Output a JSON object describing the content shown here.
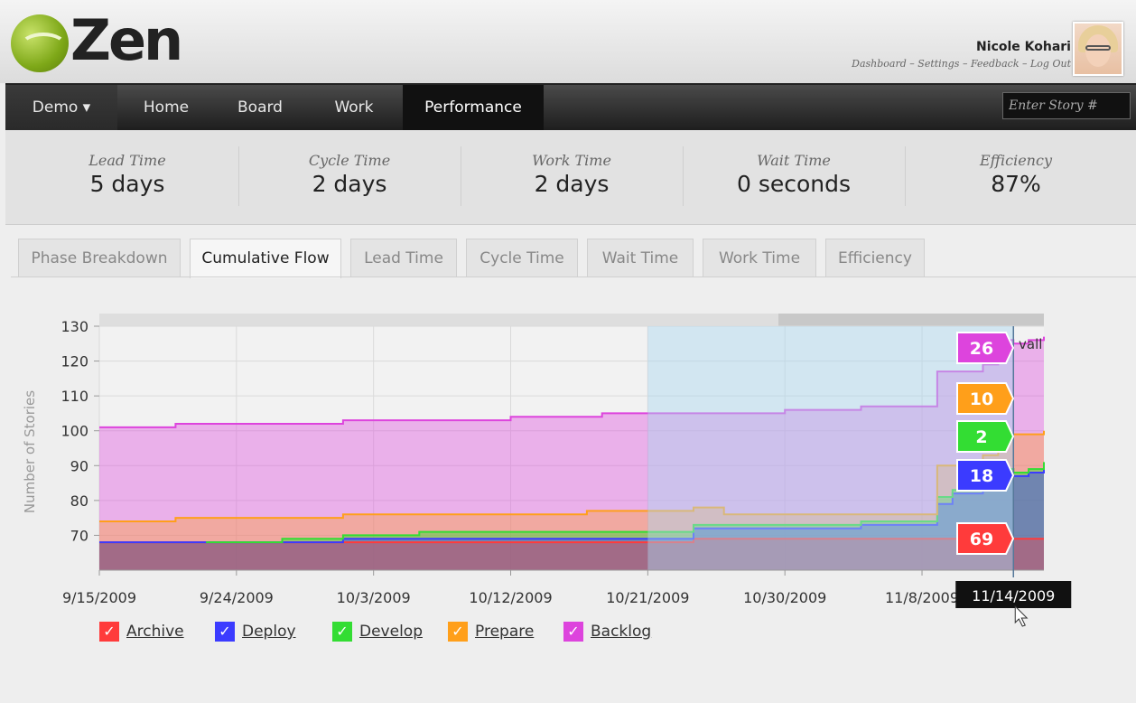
{
  "app": {
    "logo_text": "Zen"
  },
  "user": {
    "name": "Nicole Kohari",
    "links": [
      "Dashboard",
      "Settings",
      "Feedback",
      "Log Out"
    ]
  },
  "nav": {
    "demo_label": "Demo ▾",
    "items": [
      "Home",
      "Board",
      "Work",
      "Performance"
    ],
    "active": "Performance",
    "story_placeholder": "Enter Story #"
  },
  "stats": [
    {
      "label": "Lead Time",
      "value": "5 days"
    },
    {
      "label": "Cycle Time",
      "value": "2 days"
    },
    {
      "label": "Work Time",
      "value": "2 days"
    },
    {
      "label": "Wait Time",
      "value": "0 seconds"
    },
    {
      "label": "Efficiency",
      "value": "87%"
    }
  ],
  "tabs": [
    "Phase Breakdown",
    "Cumulative Flow",
    "Lead Time",
    "Cycle Time",
    "Wait Time",
    "Work Time",
    "Efficiency"
  ],
  "active_tab": "Cumulative Flow",
  "colors": {
    "archive": "#ff3b3b",
    "deploy": "#3b3bff",
    "develop": "#33dd33",
    "prepare": "#ff9f1a",
    "backlog": "#dd44dd",
    "selection": "#aad8f0",
    "navbar": "#2a2a2a"
  },
  "chart_data": {
    "type": "area",
    "stacked": true,
    "ylabel": "Number of Stories",
    "ylim": [
      60,
      130
    ],
    "yticks": [
      70,
      80,
      90,
      100,
      110,
      120,
      130
    ],
    "x_tick_labels": [
      "9/15/2009",
      "9/24/2009",
      "10/3/2009",
      "10/12/2009",
      "10/21/2009",
      "10/30/2009",
      "11/8/2009"
    ],
    "x_start": "9/15/2009",
    "x_end": "11/16/2009",
    "selection_range": [
      "10/21/2009",
      "11/14/2009"
    ],
    "hover_date": "11/14/2009",
    "overlay_text": "vall",
    "dates": [
      "9/15/2009",
      "9/19/2009",
      "9/20/2009",
      "9/26/2009",
      "9/27/2009",
      "10/1/2009",
      "10/5/2009",
      "10/6/2009",
      "10/12/2009",
      "10/17/2009",
      "10/18/2009",
      "10/24/2009",
      "10/26/2009",
      "10/30/2009",
      "10/31/2009",
      "11/3/2009",
      "11/4/2009",
      "11/6/2009",
      "11/7/2009",
      "11/9/2009",
      "11/10/2009",
      "11/12/2009",
      "11/13/2009",
      "11/14/2009",
      "11/15/2009",
      "11/16/2009"
    ],
    "series": [
      {
        "name": "Archive",
        "color": "#ff3b3b",
        "values": [
          68,
          68,
          68,
          68,
          68,
          68,
          68,
          68,
          68,
          68,
          68,
          69,
          69,
          69,
          69,
          69,
          69,
          69,
          69,
          69,
          69,
          69,
          69,
          69,
          69,
          69
        ]
      },
      {
        "name": "Deploy",
        "color": "#3b3bff",
        "values": [
          68,
          68,
          68,
          68,
          68,
          69,
          69,
          69,
          69,
          69,
          69,
          72,
          72,
          72,
          72,
          72,
          73,
          73,
          73,
          79,
          82,
          84,
          87,
          87,
          88,
          89
        ]
      },
      {
        "name": "Develop",
        "color": "#33dd33",
        "values": [
          68,
          68,
          68,
          68,
          69,
          70,
          70,
          71,
          71,
          71,
          71,
          73,
          73,
          73,
          73,
          73,
          74,
          74,
          74,
          81,
          83,
          86,
          89,
          88,
          89,
          91
        ]
      },
      {
        "name": "Prepare",
        "color": "#ff9f1a",
        "values": [
          74,
          74,
          75,
          75,
          75,
          76,
          76,
          76,
          76,
          77,
          77,
          78,
          76,
          76,
          76,
          76,
          76,
          76,
          76,
          90,
          90,
          93,
          99,
          99,
          99,
          100
        ]
      },
      {
        "name": "Backlog",
        "color": "#dd44dd",
        "values": [
          101,
          101,
          102,
          102,
          102,
          103,
          103,
          103,
          104,
          104,
          105,
          105,
          105,
          106,
          106,
          106,
          107,
          107,
          107,
          117,
          117,
          119,
          126,
          125,
          126,
          127
        ]
      }
    ],
    "series_starts": {
      "Develop": "9/22/2009"
    },
    "value_labels": [
      {
        "series": "Backlog",
        "text": "26"
      },
      {
        "series": "Prepare",
        "text": "10"
      },
      {
        "series": "Develop",
        "text": "2"
      },
      {
        "series": "Deploy",
        "text": "18"
      },
      {
        "series": "Archive",
        "text": "69"
      }
    ],
    "legend": [
      "Archive",
      "Deploy",
      "Develop",
      "Prepare",
      "Backlog"
    ]
  }
}
